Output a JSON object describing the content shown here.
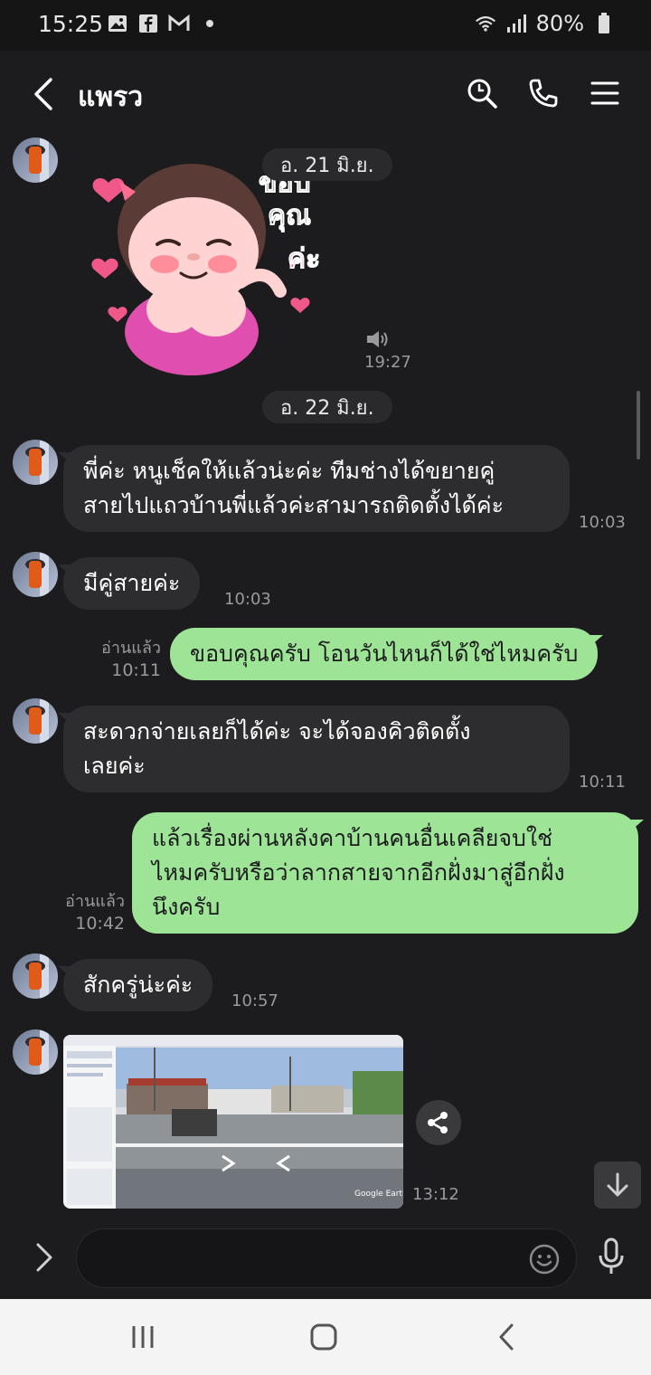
{
  "status_bar": {
    "time": "15:25",
    "battery": "80%"
  },
  "header": {
    "title": "แพรว"
  },
  "date_chips": {
    "first": "อ. 21 มิ.ย.",
    "second": "อ. 22 มิ.ย."
  },
  "sticker": {
    "time": "19:27",
    "text_line1": "ขอบ",
    "text_line2": "คุณ",
    "text_line3": "ค่ะ"
  },
  "messages": [
    {
      "direction": "in",
      "text_lines": [
        "พี่ค่ะ หนูเช็คให้แล้วน่ะค่ะ  ทีมช่างได้ขยายคู่",
        "สายไปแถวบ้านพี่แล้วค่ะสามารถติดตั้งได้ค่ะ"
      ],
      "time": "10:03"
    },
    {
      "direction": "in",
      "text_lines": [
        "มีคู่สายค่ะ"
      ],
      "time": "10:03"
    },
    {
      "direction": "out",
      "text_lines": [
        "ขอบคุณครับ โอนวันไหนก็ได้ใช่ไหมครับ"
      ],
      "read": "อ่านแล้ว",
      "time": "10:11"
    },
    {
      "direction": "in",
      "text_lines": [
        "สะดวกจ่ายเลยก็ได้ค่ะ  จะได้จองคิวติดตั้ง",
        "เลยค่ะ"
      ],
      "time": "10:11"
    },
    {
      "direction": "out",
      "text_lines": [
        "แล้วเรื่องผ่านหลังคาบ้านคนอื่นเคลียจบใช่",
        "ไหมครับหรือว่าลากสายจากอีกฝั่งมาสู่อีกฝั่ง",
        "นึงครับ"
      ],
      "read": "อ่านแล้ว",
      "time": "10:42"
    },
    {
      "direction": "in",
      "text_lines": [
        "สักครู่น่ะค่ะ"
      ],
      "time": "10:57"
    }
  ],
  "photo_message": {
    "time": "13:12",
    "watermark": "Google Earth"
  },
  "colors": {
    "background": "#1c1c1e",
    "incoming": "#2d2d2f",
    "outgoing": "#9ee497"
  },
  "icons": [
    "back-arrow-icon",
    "search-icon",
    "phone-icon",
    "menu-icon",
    "share-icon",
    "arrow-down-icon",
    "chevron-right-icon",
    "emoji-icon",
    "mic-icon"
  ]
}
